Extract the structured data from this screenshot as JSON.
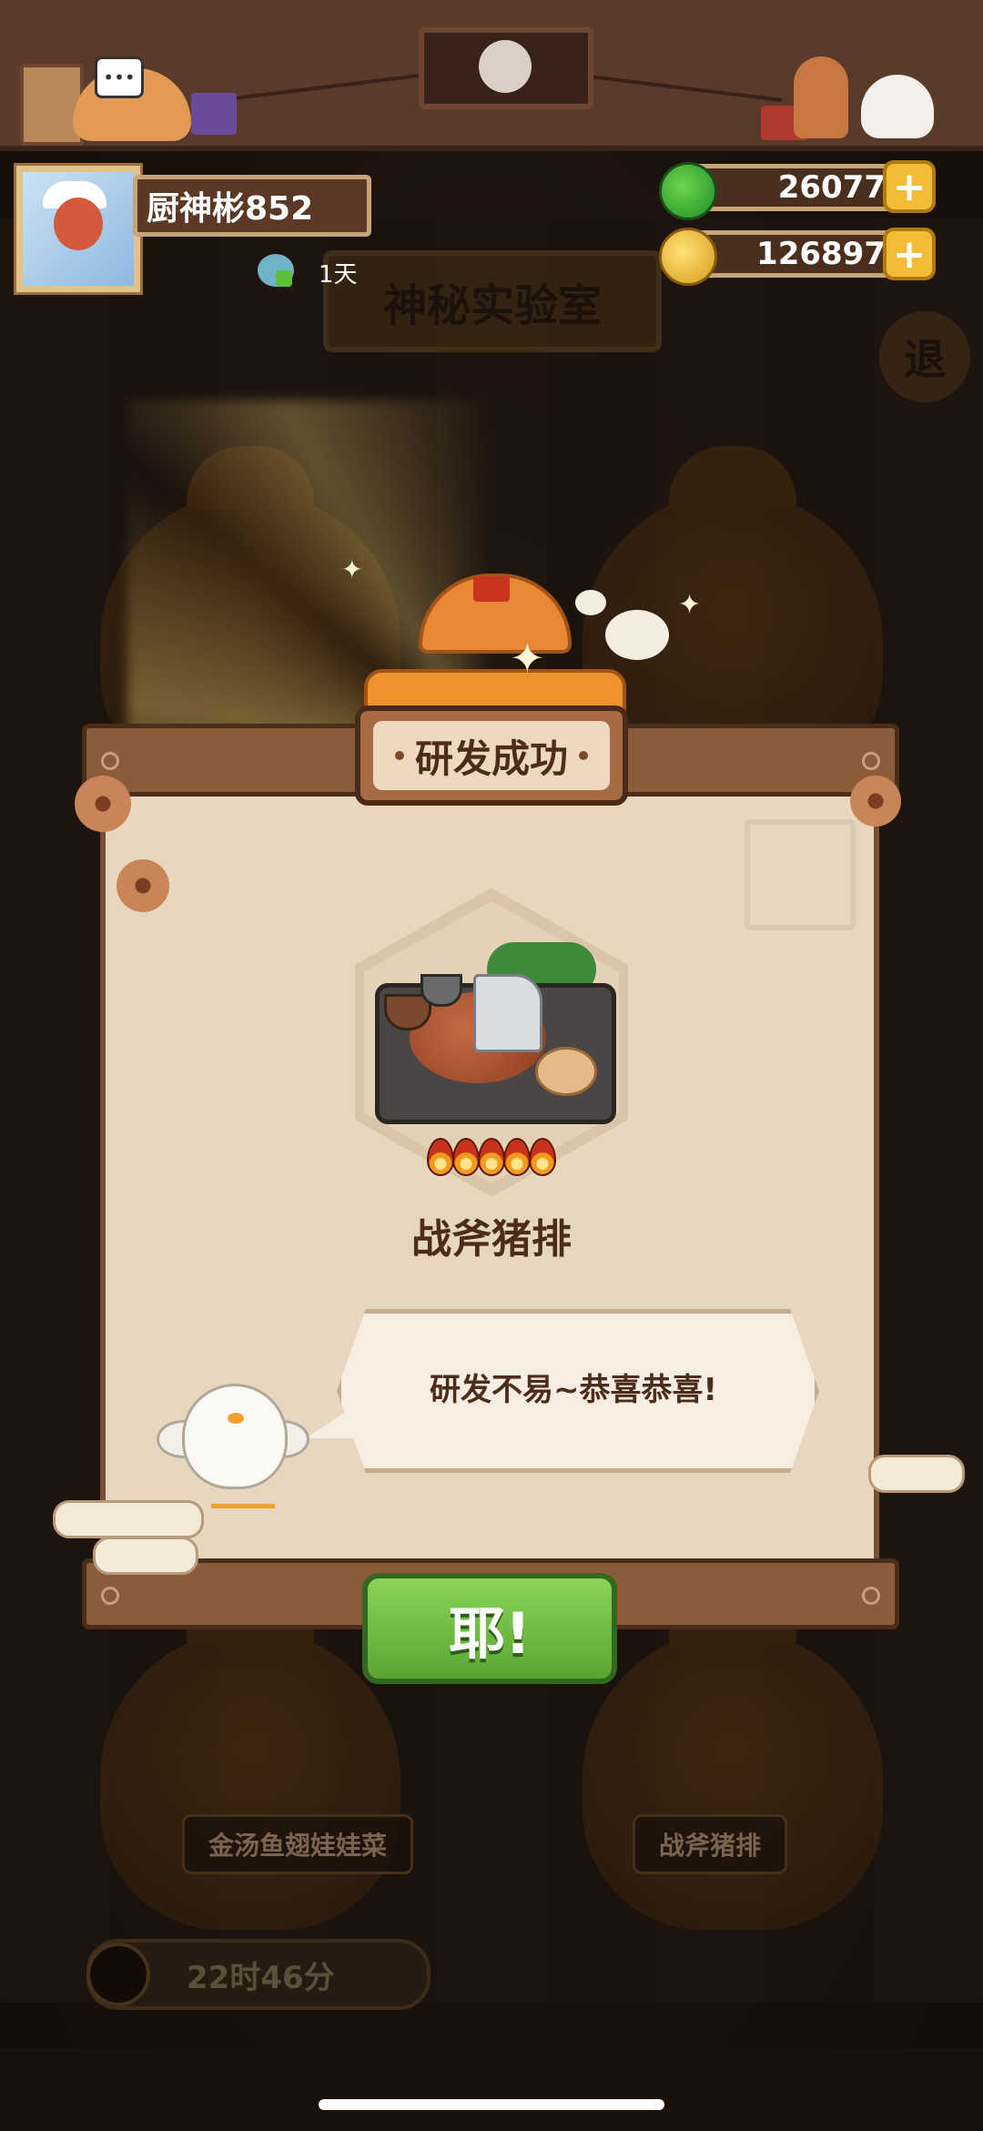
{
  "header": {
    "player_name": "厨神彬852",
    "login_days": "1天",
    "jade_count": "26077",
    "gold_count": "126897",
    "plus_label": "+"
  },
  "background": {
    "lab_title": "神秘实验室",
    "exit_label": "退",
    "pot_left_label": "金汤鱼翅娃娃菜",
    "pot_right_label": "战斧猪排",
    "timer_text": "22时46分"
  },
  "popup": {
    "title": "研发成功",
    "dish_name": "战斧猪排",
    "dish_rating_flames": 5,
    "speech": "研发不易~恭喜恭喜!",
    "confirm_label": "耶!"
  },
  "colors": {
    "accent_green": "#5aa532",
    "gold": "#f3bc34",
    "parchment": "#e8d7bf",
    "wood": "#8a5c3a"
  }
}
